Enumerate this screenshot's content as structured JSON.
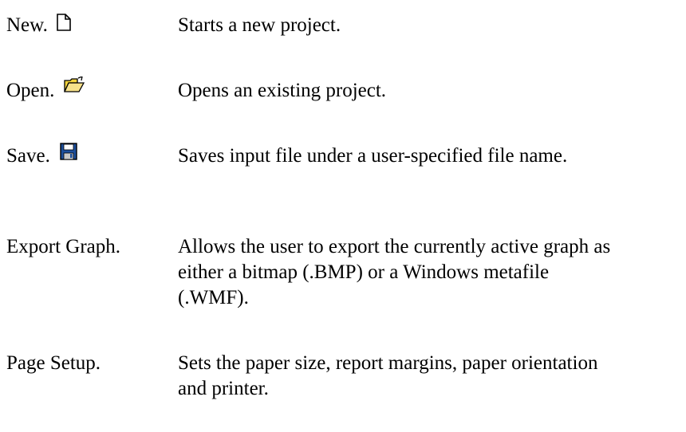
{
  "entries": [
    {
      "term": "New.",
      "icon": "new-document-icon",
      "description": "Starts a new project."
    },
    {
      "term": "Open.",
      "icon": "open-folder-icon",
      "description": "Opens an existing project."
    },
    {
      "term": "Save.",
      "icon": "floppy-disk-icon",
      "description": "Saves input file under a user-specified file name."
    },
    {
      "term": "Export Graph.",
      "icon": "",
      "description": "Allows the user to export the currently active graph as either a bitmap (.BMP) or a Windows metafile (.WMF)."
    },
    {
      "term": "Page Setup.",
      "icon": "",
      "description": "Sets the paper size, report margins, paper orientation and printer."
    }
  ],
  "colors": {
    "text": "#000000",
    "folder_yellow": "#f2d23a",
    "floppy_blue": "#1d4f9c"
  }
}
